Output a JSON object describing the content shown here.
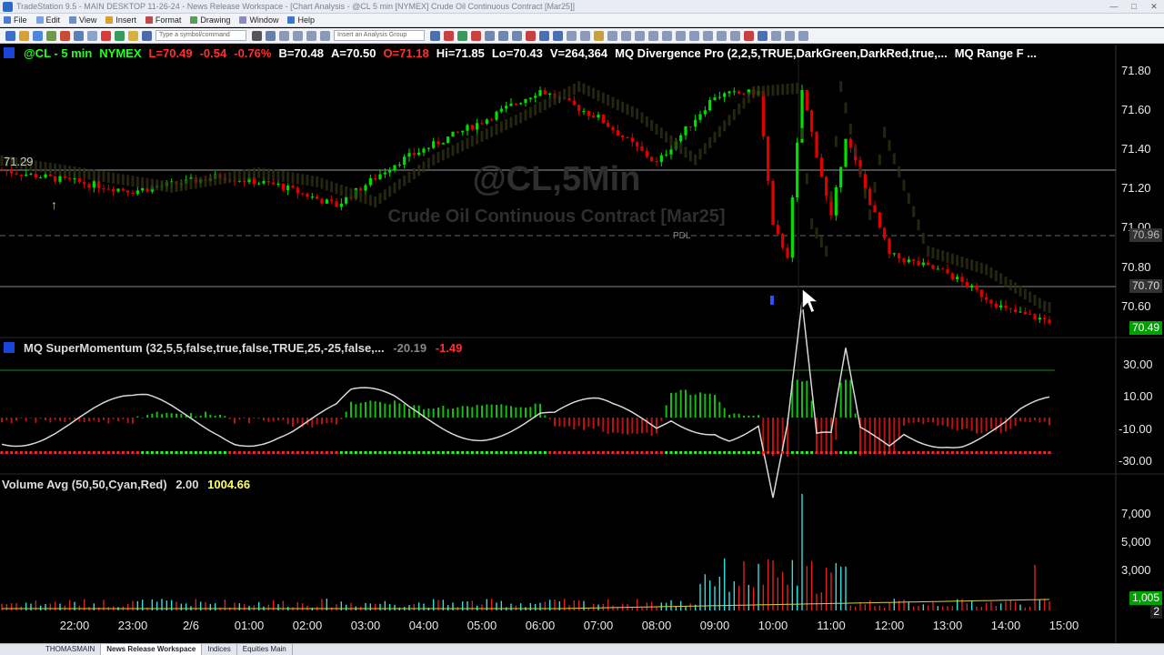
{
  "window": {
    "title": "TradeStation 9.5 - MAIN DESKTOP 11-26-24 - News Release Workspace - [Chart Analysis - @CL 5 min [NYMEX] Crude Oil Continuous Contract [Mar25]]"
  },
  "menu": {
    "items": [
      "File",
      "Edit",
      "View",
      "Insert",
      "Format",
      "Drawing",
      "Window",
      "Help"
    ]
  },
  "toolbar": {
    "symbol_placeholder": "Type a symbol/command",
    "analysis_placeholder": "Insert an Analysis Group"
  },
  "header": {
    "symbol": "@CL - 5 min",
    "exchange": "NYMEX",
    "last": "L=70.49",
    "change": "-0.54",
    "change_pct": "-0.76%",
    "bid": "B=70.48",
    "ask": "A=70.50",
    "open": "O=71.18",
    "high": "Hi=71.85",
    "low": "Lo=70.43",
    "volume": "V=264,364",
    "study1": "MQ Divergence Pro (2,2,5,TRUE,DarkGreen,DarkRed,true,...",
    "study2": "MQ Range F ..."
  },
  "watermark": {
    "symbol": "@CL,5Min",
    "description": "Crude Oil Continuous Contract [Mar25]"
  },
  "price_panel": {
    "left_marker": "71.29",
    "pdl_label": "PDL",
    "y_ticks": [
      "71.80",
      "71.60",
      "71.40",
      "71.20",
      "71.00",
      "70.80",
      "70.60"
    ],
    "tag_pdl": "70.96",
    "tag_level": "70.70",
    "tag_last": "70.49",
    "ylim": [
      70.4,
      71.85
    ]
  },
  "momentum_panel": {
    "title": "MQ SuperMomentum (32,5,5,false,true,false,TRUE,25,-25,false,...",
    "value1": "-20.19",
    "value2": "-1.49",
    "y_ticks": [
      "30.00",
      "10.00",
      "-10.00",
      "-30.00"
    ]
  },
  "volume_panel": {
    "title": "Volume Avg (50,50,Cyan,Red)",
    "value1": "2.00",
    "value2": "1004.66",
    "y_ticks": [
      "7,000",
      "5,000",
      "3,000"
    ],
    "tag_avg": "1,005",
    "tag_last": "2"
  },
  "time_axis": {
    "labels": [
      "22:00",
      "23:00",
      "2/6",
      "01:00",
      "02:00",
      "03:00",
      "04:00",
      "05:00",
      "06:00",
      "07:00",
      "08:00",
      "09:00",
      "10:00",
      "11:00",
      "12:00",
      "13:00",
      "14:00",
      "15:00"
    ]
  },
  "workspace_tabs": {
    "items": [
      "THOMASMAIN",
      "News Release Workspace",
      "Indices",
      "Equities Main"
    ],
    "active": 1
  },
  "colors": {
    "up": "#00e000",
    "down": "#e00000",
    "header_symbol": "#00ff00",
    "header_red": "#ff3030",
    "header_white": "#ffffff",
    "header_yellow": "#ffff66"
  },
  "chart_data": {
    "type": "line",
    "x_label": "",
    "y_label": "",
    "series": [
      {
        "name": "",
        "x": [
          "22:00",
          "23:00",
          "01:00",
          "02:00",
          "03:00",
          "04:00",
          "05:00",
          "06:00",
          "07:00",
          "08:00",
          "09:00",
          "09:45",
          "10:00",
          "10:15",
          "10:30",
          "11:00",
          "11:15",
          "12:00",
          "13:00",
          "14:00",
          "14:45"
        ],
        "values": [
          71.25,
          71.2,
          71.28,
          71.25,
          71.18,
          71.35,
          71.55,
          71.7,
          71.55,
          71.35,
          71.7,
          71.72,
          71.0,
          70.85,
          71.75,
          71.05,
          71.5,
          70.85,
          70.75,
          70.55,
          70.49
        ]
      }
    ],
    "ylim": [
      70.4,
      71.85
    ]
  }
}
